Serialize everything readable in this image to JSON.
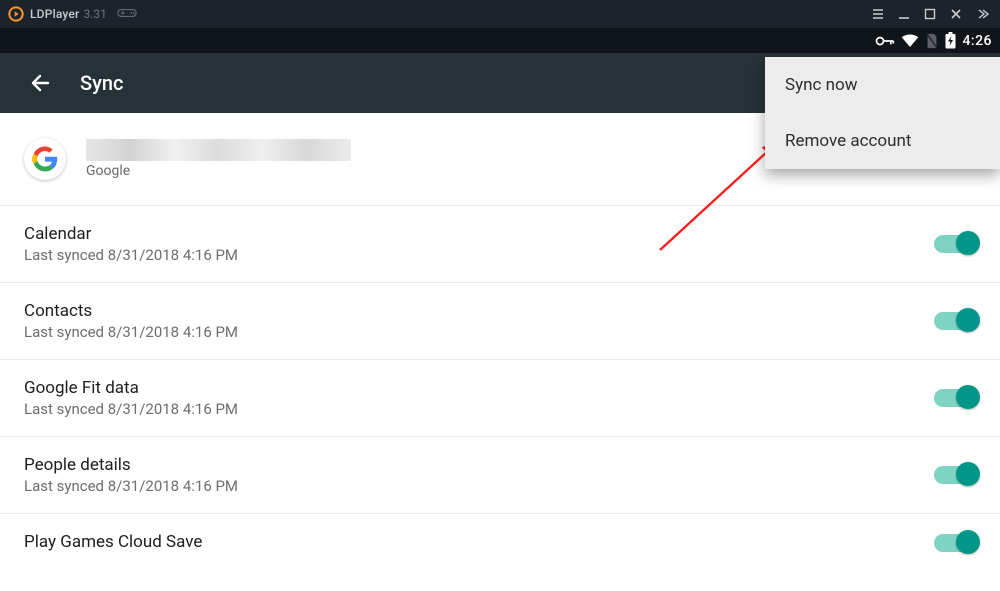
{
  "ld": {
    "title": "LDPlayer",
    "version": "3.31"
  },
  "status": {
    "time": "4:26"
  },
  "appbar": {
    "title": "Sync"
  },
  "popup": {
    "items": [
      {
        "label": "Sync now"
      },
      {
        "label": "Remove account"
      }
    ]
  },
  "account": {
    "provider": "Google"
  },
  "sync_items": [
    {
      "title": "Calendar",
      "sub": "Last synced 8/31/2018 4:16 PM",
      "on": true
    },
    {
      "title": "Contacts",
      "sub": "Last synced 8/31/2018 4:16 PM",
      "on": true
    },
    {
      "title": "Google Fit data",
      "sub": "Last synced 8/31/2018 4:16 PM",
      "on": true
    },
    {
      "title": "People details",
      "sub": "Last synced 8/31/2018 4:16 PM",
      "on": true
    },
    {
      "title": "Play Games Cloud Save",
      "sub": "",
      "on": true
    }
  ]
}
